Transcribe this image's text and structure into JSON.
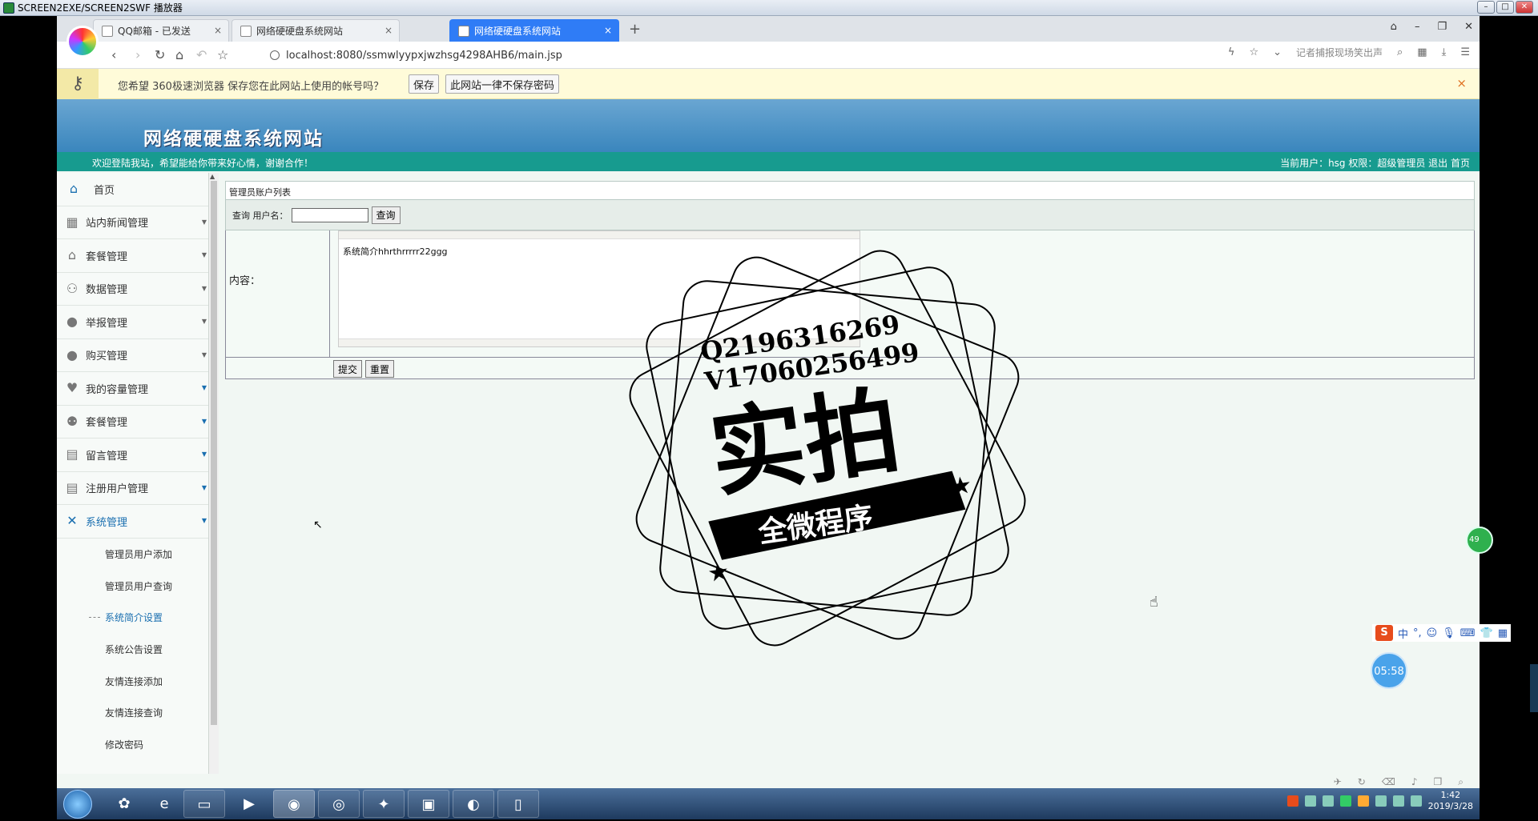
{
  "window_title": "SCREEN2EXE/SCREEN2SWF 播放器",
  "tabs": [
    {
      "label": "QQ邮箱 - 已发送",
      "close": "×"
    },
    {
      "label": "网络硬硬盘系统网站",
      "close": "×"
    },
    {
      "label": "网络硬硬盘系统网站",
      "close": "×"
    }
  ],
  "new_tab": "+",
  "url": "localhost:8080/ssmwlyypxjwzhsg4298AHB6/main.jsp",
  "search_hint": "记者捕报现场笑出声",
  "password_bar": {
    "message": "您希望 360极速浏览器 保存您在此网站上使用的帐号吗？",
    "save": "保存",
    "never": "此网站一律不保存密码",
    "close": "×"
  },
  "site": {
    "title": "网络硬硬盘系统网站",
    "welcome": "欢迎登陆我站，希望能给你带来好心情，谢谢合作！",
    "user_info": "当前用户：hsg 权限：超级管理员 退出 首页"
  },
  "sidebar": {
    "home": "首页",
    "items": [
      {
        "label": "站内新闻管理",
        "icon": "grid-icon"
      },
      {
        "label": "套餐管理",
        "icon": "home-icon"
      },
      {
        "label": "数据管理",
        "icon": "users-icon"
      },
      {
        "label": "举报管理",
        "icon": "user-icon"
      },
      {
        "label": "购买管理",
        "icon": "user-icon"
      },
      {
        "label": "我的容量管理",
        "icon": "heart-icon"
      },
      {
        "label": "套餐管理",
        "icon": "group-icon"
      },
      {
        "label": "留言管理",
        "icon": "doc-icon"
      },
      {
        "label": "注册用户管理",
        "icon": "doc-icon"
      },
      {
        "label": "系统管理",
        "icon": "tools-icon"
      }
    ],
    "sub_items": [
      "管理员用户添加",
      "管理员用户查询",
      "系统简介设置",
      "系统公告设置",
      "友情连接添加",
      "友情连接查询",
      "修改密码"
    ]
  },
  "main": {
    "panel_title": "管理员账户列表",
    "search_label": "查询 用户名：",
    "search_button": "查询",
    "content_label": "内容：",
    "editor_text": "系统简介hhrthrrrrr22ggg",
    "submit": "提交",
    "reset": "重置"
  },
  "watermark": {
    "line1": "Q2196316269",
    "line2": "V17060256499",
    "big": "实拍",
    "ribbon": "全微程序"
  },
  "overlays": {
    "badge": "49",
    "ime_s": "S",
    "ime_zh": "中",
    "timer": "05:58"
  },
  "taskbar": {
    "time": "1:42",
    "date": "2019/3/28"
  }
}
